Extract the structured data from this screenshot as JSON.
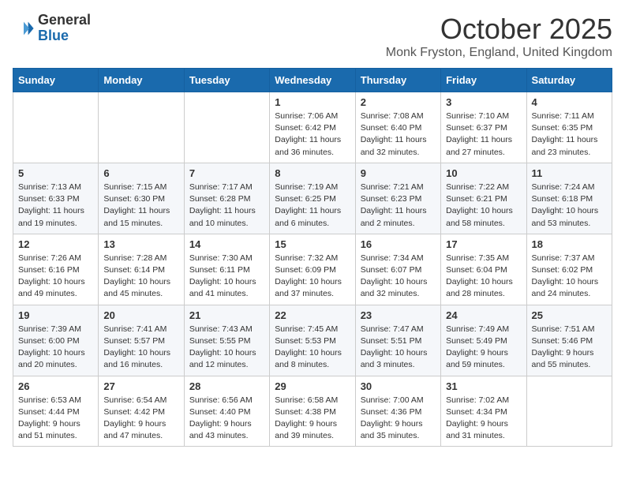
{
  "header": {
    "logo_general": "General",
    "logo_blue": "Blue",
    "month_title": "October 2025",
    "location": "Monk Fryston, England, United Kingdom"
  },
  "weekdays": [
    "Sunday",
    "Monday",
    "Tuesday",
    "Wednesday",
    "Thursday",
    "Friday",
    "Saturday"
  ],
  "weeks": [
    [
      {
        "day": "",
        "info": ""
      },
      {
        "day": "",
        "info": ""
      },
      {
        "day": "",
        "info": ""
      },
      {
        "day": "1",
        "info": "Sunrise: 7:06 AM\nSunset: 6:42 PM\nDaylight: 11 hours\nand 36 minutes."
      },
      {
        "day": "2",
        "info": "Sunrise: 7:08 AM\nSunset: 6:40 PM\nDaylight: 11 hours\nand 32 minutes."
      },
      {
        "day": "3",
        "info": "Sunrise: 7:10 AM\nSunset: 6:37 PM\nDaylight: 11 hours\nand 27 minutes."
      },
      {
        "day": "4",
        "info": "Sunrise: 7:11 AM\nSunset: 6:35 PM\nDaylight: 11 hours\nand 23 minutes."
      }
    ],
    [
      {
        "day": "5",
        "info": "Sunrise: 7:13 AM\nSunset: 6:33 PM\nDaylight: 11 hours\nand 19 minutes."
      },
      {
        "day": "6",
        "info": "Sunrise: 7:15 AM\nSunset: 6:30 PM\nDaylight: 11 hours\nand 15 minutes."
      },
      {
        "day": "7",
        "info": "Sunrise: 7:17 AM\nSunset: 6:28 PM\nDaylight: 11 hours\nand 10 minutes."
      },
      {
        "day": "8",
        "info": "Sunrise: 7:19 AM\nSunset: 6:25 PM\nDaylight: 11 hours\nand 6 minutes."
      },
      {
        "day": "9",
        "info": "Sunrise: 7:21 AM\nSunset: 6:23 PM\nDaylight: 11 hours\nand 2 minutes."
      },
      {
        "day": "10",
        "info": "Sunrise: 7:22 AM\nSunset: 6:21 PM\nDaylight: 10 hours\nand 58 minutes."
      },
      {
        "day": "11",
        "info": "Sunrise: 7:24 AM\nSunset: 6:18 PM\nDaylight: 10 hours\nand 53 minutes."
      }
    ],
    [
      {
        "day": "12",
        "info": "Sunrise: 7:26 AM\nSunset: 6:16 PM\nDaylight: 10 hours\nand 49 minutes."
      },
      {
        "day": "13",
        "info": "Sunrise: 7:28 AM\nSunset: 6:14 PM\nDaylight: 10 hours\nand 45 minutes."
      },
      {
        "day": "14",
        "info": "Sunrise: 7:30 AM\nSunset: 6:11 PM\nDaylight: 10 hours\nand 41 minutes."
      },
      {
        "day": "15",
        "info": "Sunrise: 7:32 AM\nSunset: 6:09 PM\nDaylight: 10 hours\nand 37 minutes."
      },
      {
        "day": "16",
        "info": "Sunrise: 7:34 AM\nSunset: 6:07 PM\nDaylight: 10 hours\nand 32 minutes."
      },
      {
        "day": "17",
        "info": "Sunrise: 7:35 AM\nSunset: 6:04 PM\nDaylight: 10 hours\nand 28 minutes."
      },
      {
        "day": "18",
        "info": "Sunrise: 7:37 AM\nSunset: 6:02 PM\nDaylight: 10 hours\nand 24 minutes."
      }
    ],
    [
      {
        "day": "19",
        "info": "Sunrise: 7:39 AM\nSunset: 6:00 PM\nDaylight: 10 hours\nand 20 minutes."
      },
      {
        "day": "20",
        "info": "Sunrise: 7:41 AM\nSunset: 5:57 PM\nDaylight: 10 hours\nand 16 minutes."
      },
      {
        "day": "21",
        "info": "Sunrise: 7:43 AM\nSunset: 5:55 PM\nDaylight: 10 hours\nand 12 minutes."
      },
      {
        "day": "22",
        "info": "Sunrise: 7:45 AM\nSunset: 5:53 PM\nDaylight: 10 hours\nand 8 minutes."
      },
      {
        "day": "23",
        "info": "Sunrise: 7:47 AM\nSunset: 5:51 PM\nDaylight: 10 hours\nand 3 minutes."
      },
      {
        "day": "24",
        "info": "Sunrise: 7:49 AM\nSunset: 5:49 PM\nDaylight: 9 hours\nand 59 minutes."
      },
      {
        "day": "25",
        "info": "Sunrise: 7:51 AM\nSunset: 5:46 PM\nDaylight: 9 hours\nand 55 minutes."
      }
    ],
    [
      {
        "day": "26",
        "info": "Sunrise: 6:53 AM\nSunset: 4:44 PM\nDaylight: 9 hours\nand 51 minutes."
      },
      {
        "day": "27",
        "info": "Sunrise: 6:54 AM\nSunset: 4:42 PM\nDaylight: 9 hours\nand 47 minutes."
      },
      {
        "day": "28",
        "info": "Sunrise: 6:56 AM\nSunset: 4:40 PM\nDaylight: 9 hours\nand 43 minutes."
      },
      {
        "day": "29",
        "info": "Sunrise: 6:58 AM\nSunset: 4:38 PM\nDaylight: 9 hours\nand 39 minutes."
      },
      {
        "day": "30",
        "info": "Sunrise: 7:00 AM\nSunset: 4:36 PM\nDaylight: 9 hours\nand 35 minutes."
      },
      {
        "day": "31",
        "info": "Sunrise: 7:02 AM\nSunset: 4:34 PM\nDaylight: 9 hours\nand 31 minutes."
      },
      {
        "day": "",
        "info": ""
      }
    ]
  ]
}
